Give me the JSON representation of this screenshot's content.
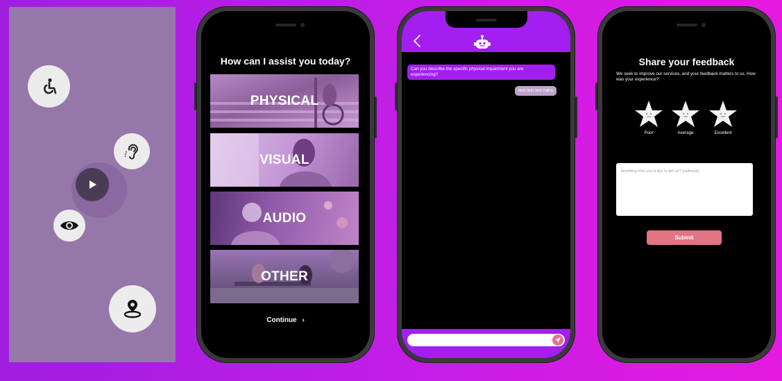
{
  "accessibility_panel": {
    "icons": [
      "wheelchair-icon",
      "hearing-icon",
      "play-icon",
      "eye-icon",
      "location-pin-icon"
    ]
  },
  "assist_screen": {
    "title": "How can I assist you today?",
    "categories": [
      {
        "label": "PHYSICAL"
      },
      {
        "label": "VISUAL"
      },
      {
        "label": "AUDIO"
      },
      {
        "label": "OTHER"
      }
    ],
    "continue_label": "Continue",
    "continue_icon": "chevron-right-icon"
  },
  "chat_screen": {
    "header_icons": [
      "back-icon",
      "robot-icon"
    ],
    "messages": [
      {
        "from": "bot",
        "text": "Can you describe the specific physical impairment you are experiencing?"
      },
      {
        "from": "user",
        "text": "test test test haha"
      }
    ],
    "input_value": "",
    "send_icon": "send-icon"
  },
  "feedback_screen": {
    "title": "Share your feedback",
    "description": "We seek to improve our services, and your feedback matters to us. How was your experience?",
    "ratings": [
      {
        "label": "Poor"
      },
      {
        "label": "Average"
      },
      {
        "label": "Excellent"
      }
    ],
    "comment_placeholder": "Anything else you'd like to tell us? (optional)",
    "submit_label": "Submit"
  },
  "colors": {
    "background_start": "#a01de0",
    "background_end": "#e51ae0",
    "panel": "#9677a9",
    "chat_accent": "#a21ff0",
    "bot_bubble": "#a21ff0",
    "user_bubble": "#bda4c8",
    "submit": "#e27483"
  }
}
